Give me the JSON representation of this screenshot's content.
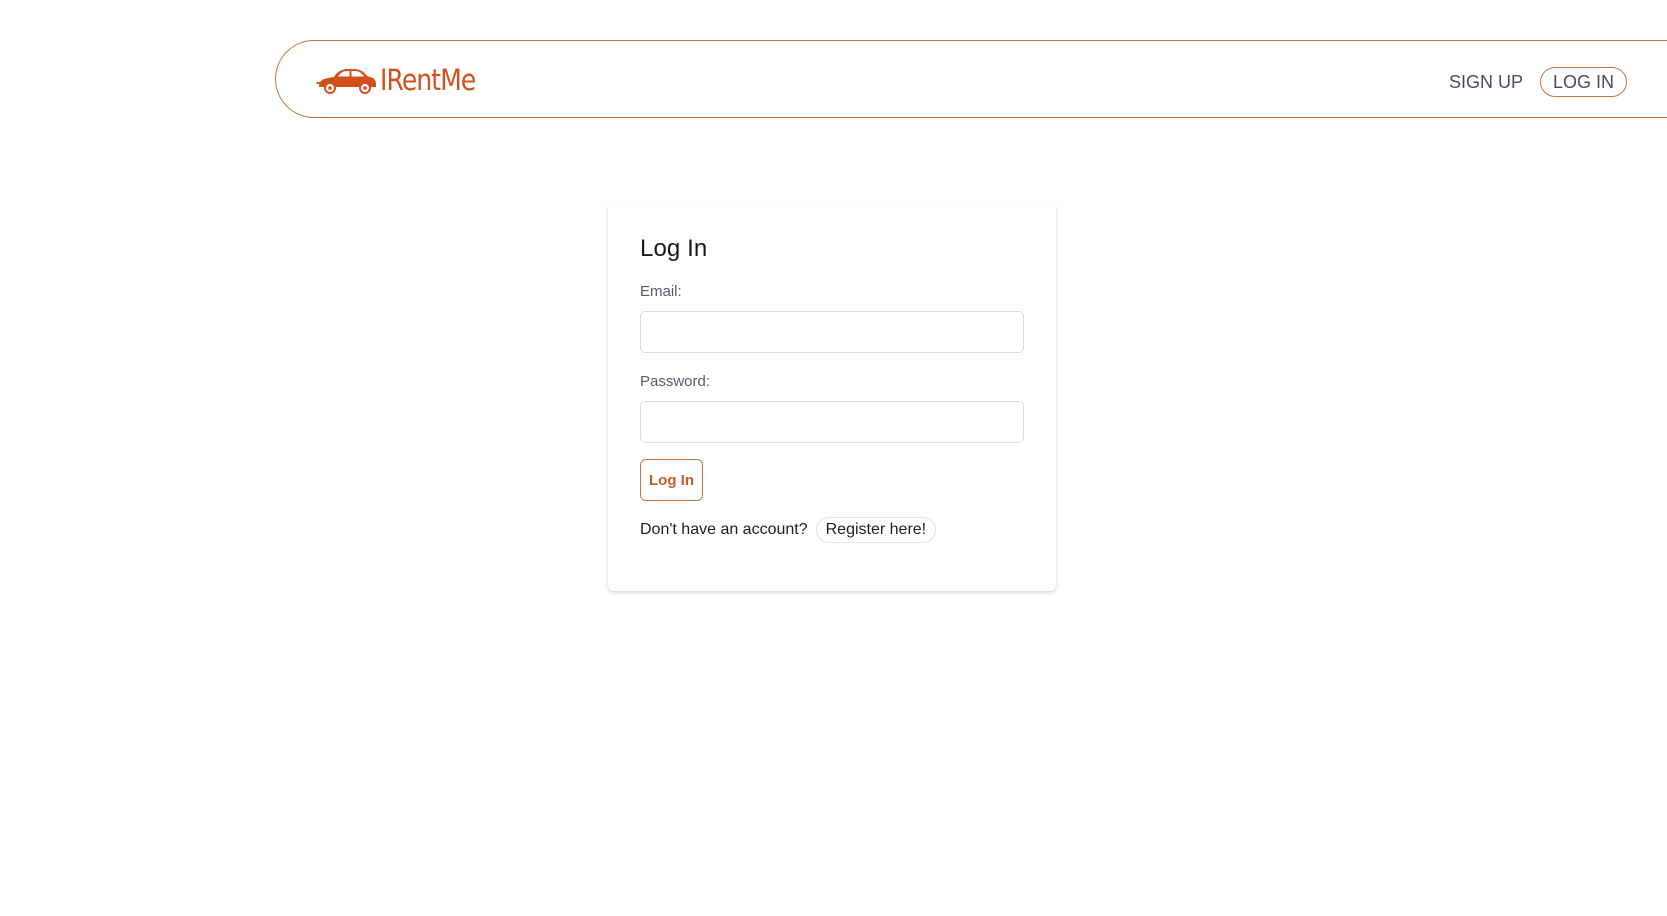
{
  "header": {
    "brand_name": "IRentMe",
    "brand_icon": "car-icon",
    "brand_color": "#d4501a",
    "accent_color": "#c8743e",
    "nav": {
      "signup_label": "SIGN UP",
      "login_label": "LOG IN"
    }
  },
  "login_form": {
    "title": "Log In",
    "email": {
      "label": "Email:",
      "value": "",
      "placeholder": ""
    },
    "password": {
      "label": "Password:",
      "value": "",
      "placeholder": ""
    },
    "submit_label": "Log In",
    "register_prompt": "Don't have an account?",
    "register_link_label": "Register here!"
  }
}
